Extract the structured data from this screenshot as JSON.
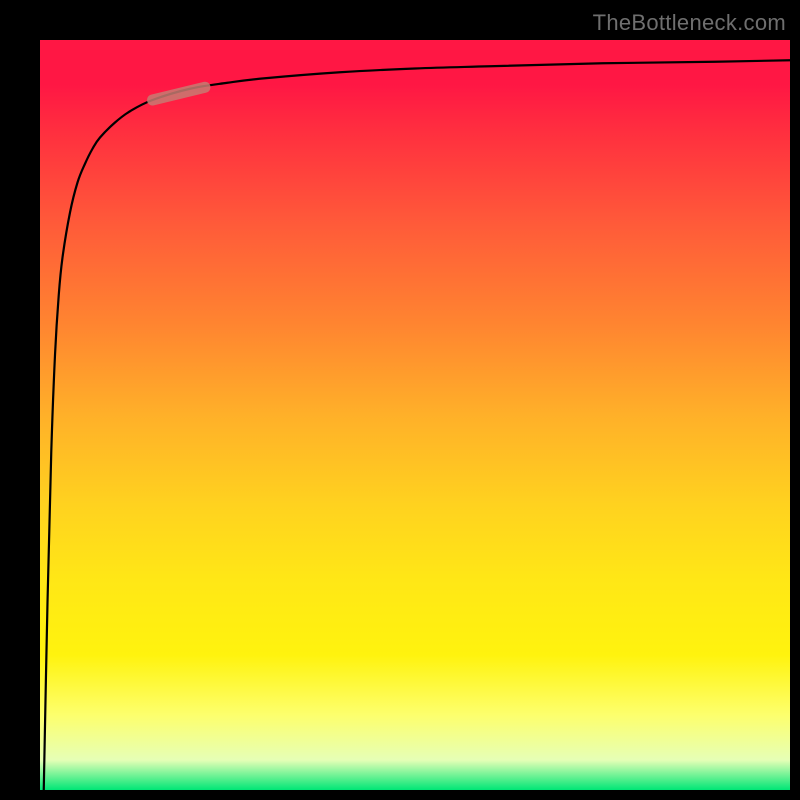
{
  "watermark": "TheBottleneck.com",
  "colors": {
    "background": "#000000",
    "curve": "#000000",
    "highlight": "#c77b72",
    "gradient_top": "#ff1744",
    "gradient_mid": "#ffd21f",
    "gradient_bottom": "#00e676"
  },
  "chart_data": {
    "type": "line",
    "title": "",
    "xlabel": "",
    "ylabel": "",
    "xlim": [
      0,
      100
    ],
    "ylim": [
      0,
      100
    ],
    "grid": false,
    "legend": false,
    "series": [
      {
        "name": "curve",
        "x": [
          0.5,
          1.0,
          1.5,
          2.0,
          2.5,
          3.0,
          4.0,
          5.0,
          6.0,
          7.0,
          8.0,
          10.0,
          12.0,
          15.0,
          20.0,
          25.0,
          30.0,
          40.0,
          50.0,
          60.0,
          75.0,
          90.0,
          100.0
        ],
        "y": [
          0.0,
          25.0,
          45.0,
          58.0,
          66.0,
          71.0,
          77.0,
          81.0,
          83.5,
          85.5,
          87.0,
          89.0,
          90.5,
          92.0,
          93.5,
          94.3,
          94.9,
          95.7,
          96.2,
          96.5,
          96.9,
          97.1,
          97.3
        ]
      },
      {
        "name": "highlight-segment",
        "x": [
          15.0,
          22.0
        ],
        "y": [
          92.0,
          93.7
        ]
      }
    ],
    "notes": "Background vertical gradient encodes value from red (high y) through orange/yellow to green (low y). Curve rises steeply from origin then asymptotes toward ~97."
  }
}
